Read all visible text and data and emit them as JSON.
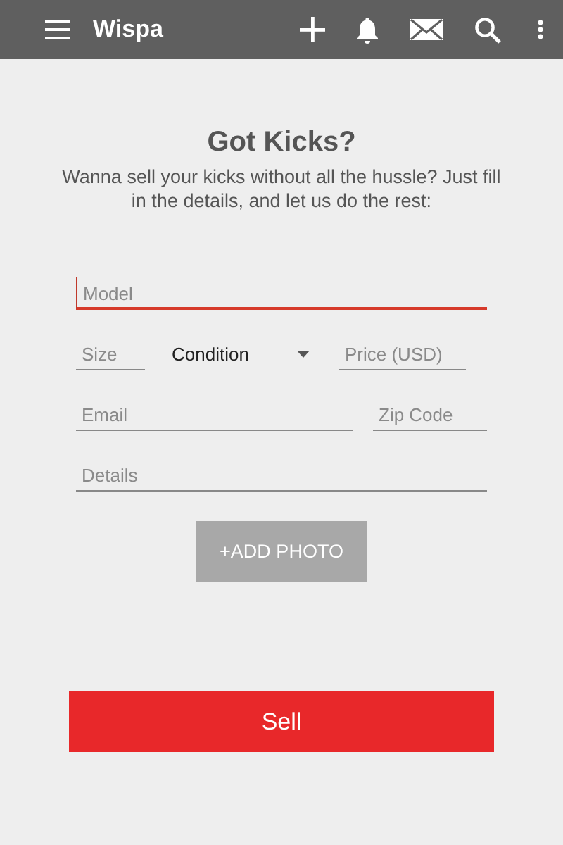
{
  "app_bar": {
    "title": "Wispa"
  },
  "heading": "Got Kicks?",
  "subtitle": "Wanna sell your kicks without all the hussle? Just fill in the details, and let us do the rest:",
  "form_rows": [
    {
      "fields": [
        {
          "kind": "text",
          "placeholder": "Model",
          "focused": true
        }
      ]
    },
    {
      "fields": [
        {
          "kind": "text",
          "placeholder": "Size",
          "focused": false
        },
        {
          "kind": "dropdown",
          "value": "Condition"
        },
        {
          "kind": "text",
          "placeholder": "Price (USD)",
          "focused": false
        }
      ]
    },
    {
      "fields": [
        {
          "kind": "text",
          "placeholder": "Email",
          "focused": false
        },
        {
          "kind": "text",
          "placeholder": "Zip Code",
          "focused": false
        }
      ]
    },
    {
      "fields": [
        {
          "kind": "text",
          "placeholder": "Details",
          "focused": false
        }
      ]
    }
  ],
  "add_photo_button": "+ADD PHOTO",
  "sell_button": "Sell"
}
